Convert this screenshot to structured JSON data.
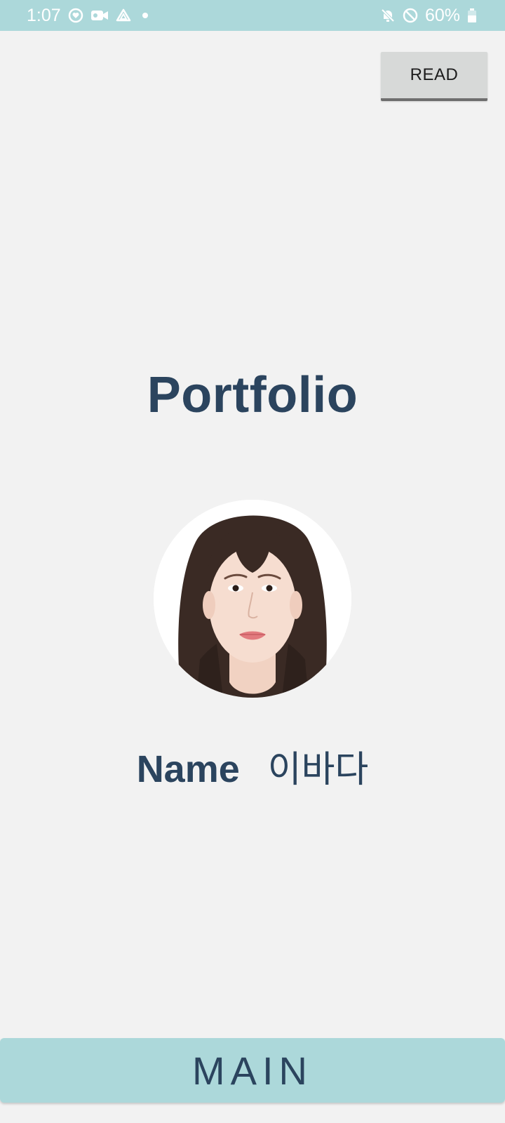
{
  "status_bar": {
    "time": "1:07",
    "battery": "60%",
    "left_icons": [
      "heart-notification-icon",
      "video-camera-icon",
      "drive-icon",
      "dot-icon"
    ],
    "right_icons": [
      "mute-icon",
      "do-not-disturb-icon",
      "battery-icon"
    ]
  },
  "header": {
    "read_label": "READ"
  },
  "main": {
    "title": "Portfolio",
    "name_label": "Name",
    "name_value": "이바다"
  },
  "footer": {
    "main_label": "MAIN"
  },
  "colors": {
    "accent": "#acd8da",
    "text_primary": "#2b445e",
    "background": "#f2f2f2"
  }
}
